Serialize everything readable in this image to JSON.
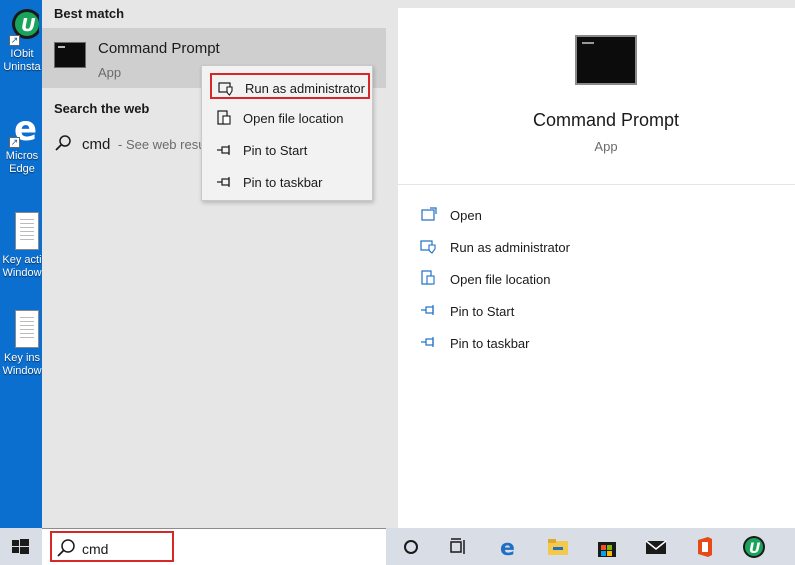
{
  "desktop": {
    "icons": [
      {
        "label_line1": "IObit",
        "label_line2": "Uninsta"
      },
      {
        "label_line1": "Micros",
        "label_line2": "Edge"
      },
      {
        "label_line1": "Key acti",
        "label_line2": "Window"
      },
      {
        "label_line1": "Key ins",
        "label_line2": "Window"
      }
    ]
  },
  "results": {
    "best_match_heading": "Best match",
    "best_match": {
      "title": "Command Prompt",
      "subtitle": "App"
    },
    "web_heading": "Search the web",
    "web_item": {
      "query": "cmd",
      "hint": "- See web resul"
    }
  },
  "context_menu": {
    "items": [
      {
        "label": "Run as administrator",
        "icon": "shield-icon"
      },
      {
        "label": "Open file location",
        "icon": "folder-icon"
      },
      {
        "label": "Pin to Start",
        "icon": "pin-icon"
      },
      {
        "label": "Pin to taskbar",
        "icon": "pin-icon"
      }
    ]
  },
  "detail": {
    "title": "Command Prompt",
    "subtitle": "App",
    "actions": [
      {
        "label": "Open",
        "icon": "open-icon"
      },
      {
        "label": "Run as administrator",
        "icon": "shield-icon"
      },
      {
        "label": "Open file location",
        "icon": "folder-icon"
      },
      {
        "label": "Pin to Start",
        "icon": "pin-icon"
      },
      {
        "label": "Pin to taskbar",
        "icon": "pin-icon"
      }
    ]
  },
  "taskbar": {
    "search_text": "cmd",
    "pinned_icons": [
      "cortana-icon",
      "task-view-icon",
      "edge-icon",
      "file-explorer-icon",
      "store-icon",
      "mail-icon",
      "office-icon",
      "iobit-icon"
    ]
  },
  "colors": {
    "accent": "#1f6fc4",
    "highlight": "#d62828"
  }
}
